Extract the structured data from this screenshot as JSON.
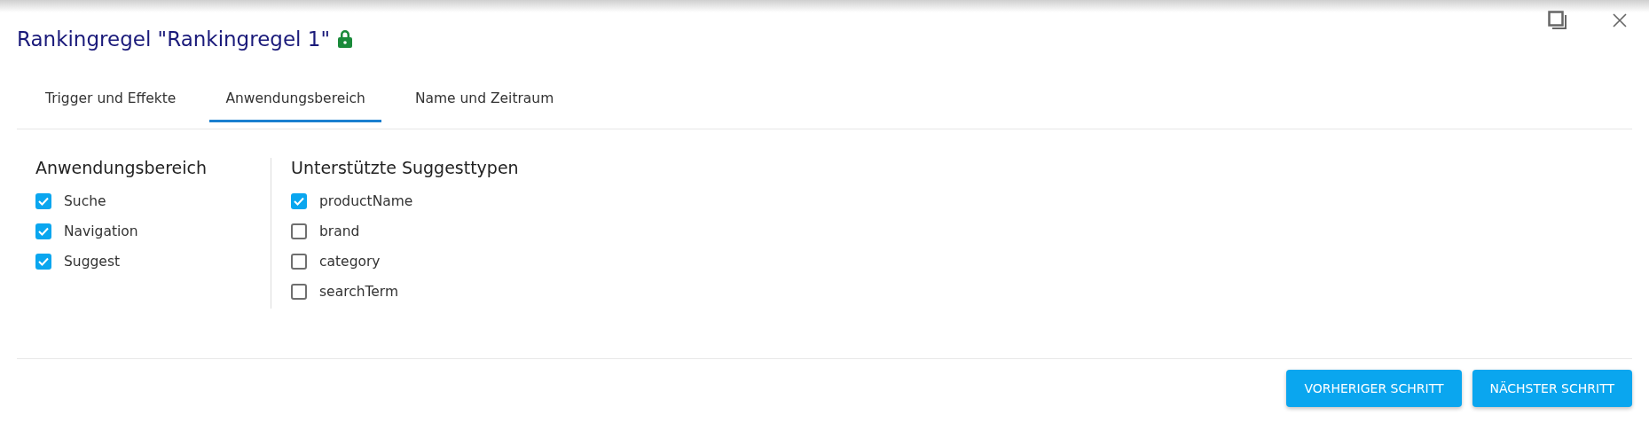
{
  "dialog": {
    "title": "Rankingregel \"Rankingregel 1\"",
    "locked": true
  },
  "tabs": [
    {
      "label": "Trigger und Effekte",
      "selected": false
    },
    {
      "label": "Anwendungsbereich",
      "selected": true
    },
    {
      "label": "Name und Zeitraum",
      "selected": false
    }
  ],
  "sections": [
    {
      "heading": "Anwendungsbereich",
      "options": [
        {
          "label": "Suche",
          "checked": true
        },
        {
          "label": "Navigation",
          "checked": true
        },
        {
          "label": "Suggest",
          "checked": true
        }
      ]
    },
    {
      "heading": "Unterstützte Suggesttypen",
      "options": [
        {
          "label": "productName",
          "checked": true
        },
        {
          "label": "brand",
          "checked": false
        },
        {
          "label": "category",
          "checked": false
        },
        {
          "label": "searchTerm",
          "checked": false
        }
      ]
    }
  ],
  "buttons": [
    "VORHERIGER SCHRITT",
    "NÄCHSTER SCHRITT"
  ]
}
